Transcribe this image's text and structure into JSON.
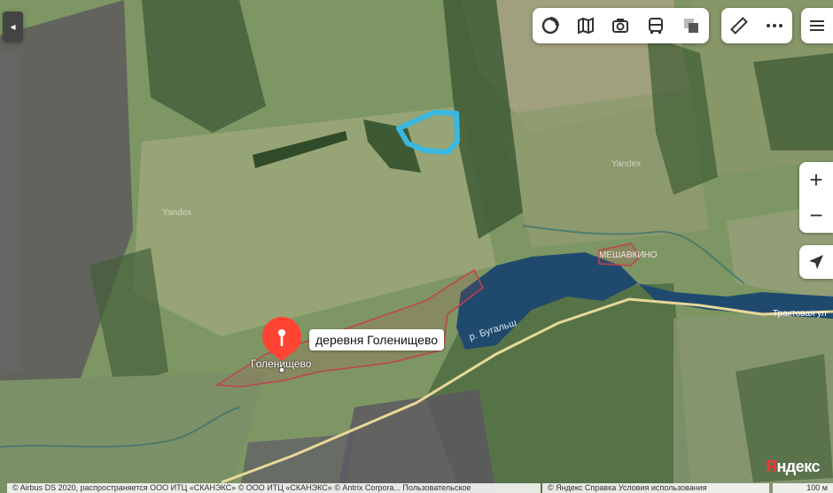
{
  "map": {
    "place_popup": "деревня Голенищево",
    "village_label": "Голенищево",
    "hamlet_label": "МЕШАВКИНО",
    "river_label": "р. Бугальш",
    "road_label": "Трактовая ул",
    "watermarks": [
      "Yandex",
      "Yandex"
    ]
  },
  "controls": {
    "collapse_arrow": "◂",
    "zoom_in": "+",
    "zoom_out": "−"
  },
  "branding": {
    "logo_first": "Я",
    "logo_rest": "ндекс"
  },
  "footer": {
    "copyright": "© Airbus DS 2020, распространяется ООО ИТЦ «СКАНЭКС» © ООО ИТЦ «СКАНЭКС» © Antrix Corpora... Пользовательское",
    "terms": "© Яндекс Справка Условия использования",
    "scale": "100 м"
  },
  "colors": {
    "marker": "#f43",
    "lake": "#1f4a6e",
    "highlight_polygon": "#3ab8e0",
    "boundary": "#c0424e",
    "road": "#e8d898"
  }
}
